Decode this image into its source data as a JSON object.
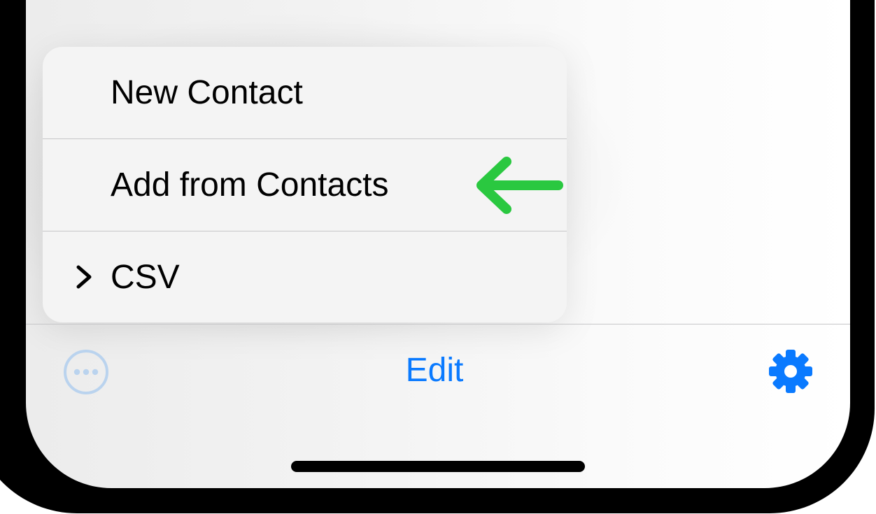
{
  "context_menu": {
    "items": [
      {
        "label": "New Contact"
      },
      {
        "label": "Add from Contacts",
        "annotation": "arrow-left-icon"
      },
      {
        "label": "CSV",
        "leading_icon": "chevron-right-icon"
      }
    ]
  },
  "toolbar": {
    "more_icon": "ellipsis-circle-icon",
    "edit_label": "Edit",
    "settings_icon": "gear-icon"
  },
  "colors": {
    "accent": "#0a7aff",
    "annotation_green": "#2ac840",
    "menu_background": "#f4f4f4",
    "more_icon_tint": "#bad3ee"
  }
}
